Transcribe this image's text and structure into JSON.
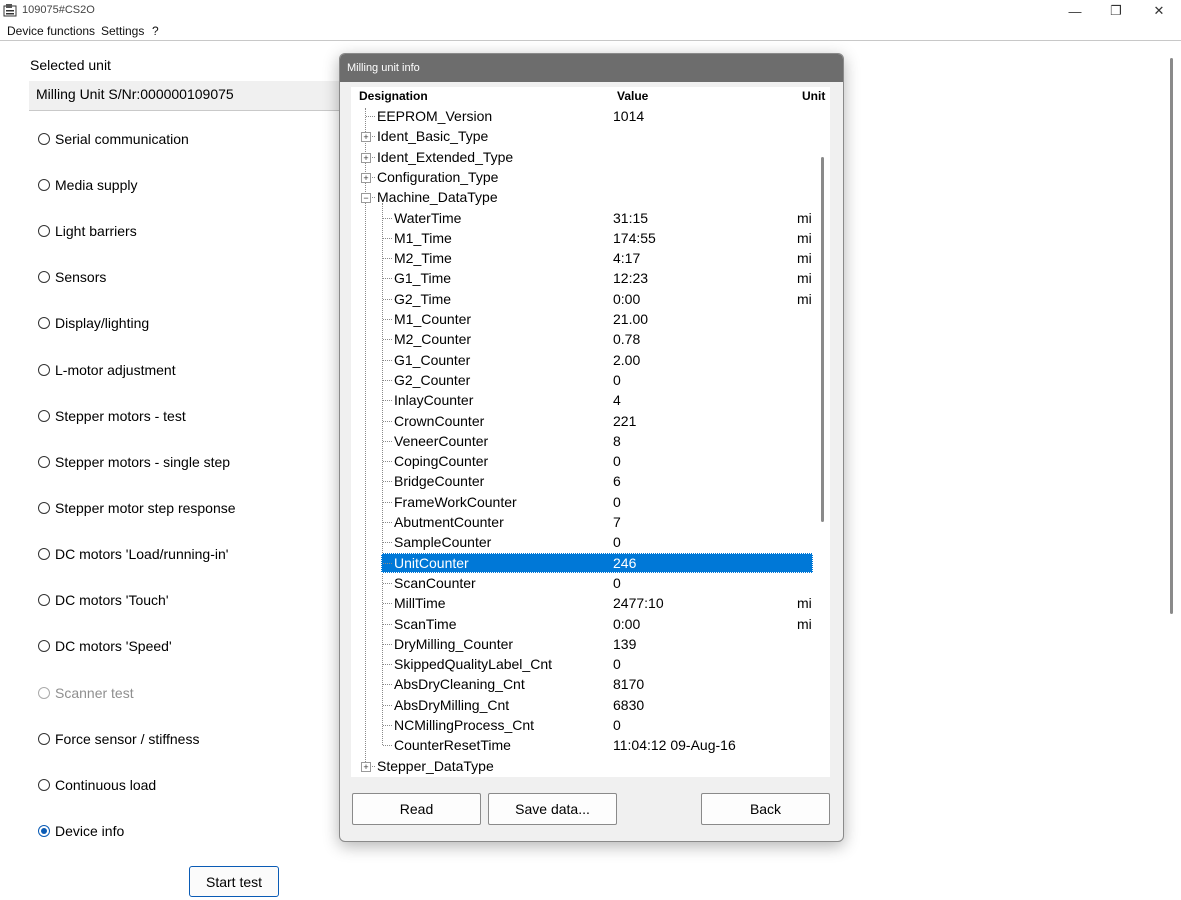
{
  "window": {
    "title": "109075#CS2O",
    "minimize_glyph": "—",
    "maximize_glyph": "❐",
    "close_glyph": "✕"
  },
  "menu": [
    "Device functions",
    "Settings",
    "?"
  ],
  "left_panel": {
    "selected_unit_label": "Selected unit",
    "unit_value": "Milling Unit S/Nr:000000109075",
    "tests": [
      {
        "label": "Serial communication",
        "state": "unchecked"
      },
      {
        "label": "Media supply",
        "state": "unchecked"
      },
      {
        "label": "Light barriers",
        "state": "unchecked"
      },
      {
        "label": "Sensors",
        "state": "unchecked"
      },
      {
        "label": "Display/lighting",
        "state": "unchecked"
      },
      {
        "label": "L-motor adjustment",
        "state": "unchecked"
      },
      {
        "label": "Stepper motors - test",
        "state": "unchecked"
      },
      {
        "label": "Stepper motors - single step",
        "state": "unchecked"
      },
      {
        "label": "Stepper motor step response",
        "state": "unchecked"
      },
      {
        "label": "DC motors 'Load/running-in'",
        "state": "unchecked"
      },
      {
        "label": "DC motors 'Touch'",
        "state": "unchecked"
      },
      {
        "label": "DC motors 'Speed'",
        "state": "unchecked"
      },
      {
        "label": "Scanner test",
        "state": "disabled"
      },
      {
        "label": "Force sensor / stiffness",
        "state": "unchecked"
      },
      {
        "label": "Continuous load",
        "state": "unchecked"
      },
      {
        "label": "Device info",
        "state": "checked"
      }
    ],
    "start_button": "Start test"
  },
  "dialog": {
    "title": "Milling unit info",
    "columns": {
      "designation": "Designation",
      "value": "Value",
      "unit": "Unit"
    },
    "rows": [
      {
        "name": "EEPROM_Version",
        "value": "1014",
        "unit": "",
        "level": 0,
        "expander": ""
      },
      {
        "name": "Ident_Basic_Type",
        "value": "",
        "unit": "",
        "level": 0,
        "expander": "+"
      },
      {
        "name": "Ident_Extended_Type",
        "value": "",
        "unit": "",
        "level": 0,
        "expander": "+"
      },
      {
        "name": "Configuration_Type",
        "value": "",
        "unit": "",
        "level": 0,
        "expander": "+"
      },
      {
        "name": "Machine_DataType",
        "value": "",
        "unit": "",
        "level": 0,
        "expander": "-"
      },
      {
        "name": "WaterTime",
        "value": "31:15",
        "unit": "mi",
        "level": 1,
        "expander": ""
      },
      {
        "name": "M1_Time",
        "value": "174:55",
        "unit": "mi",
        "level": 1,
        "expander": ""
      },
      {
        "name": "M2_Time",
        "value": "4:17",
        "unit": "mi",
        "level": 1,
        "expander": ""
      },
      {
        "name": "G1_Time",
        "value": "12:23",
        "unit": "mi",
        "level": 1,
        "expander": ""
      },
      {
        "name": "G2_Time",
        "value": "0:00",
        "unit": "mi",
        "level": 1,
        "expander": ""
      },
      {
        "name": "M1_Counter",
        "value": "21.00",
        "unit": "",
        "level": 1,
        "expander": ""
      },
      {
        "name": "M2_Counter",
        "value": "0.78",
        "unit": "",
        "level": 1,
        "expander": ""
      },
      {
        "name": "G1_Counter",
        "value": "2.00",
        "unit": "",
        "level": 1,
        "expander": ""
      },
      {
        "name": "G2_Counter",
        "value": "0",
        "unit": "",
        "level": 1,
        "expander": ""
      },
      {
        "name": "InlayCounter",
        "value": "4",
        "unit": "",
        "level": 1,
        "expander": ""
      },
      {
        "name": "CrownCounter",
        "value": "221",
        "unit": "",
        "level": 1,
        "expander": ""
      },
      {
        "name": "VeneerCounter",
        "value": "8",
        "unit": "",
        "level": 1,
        "expander": ""
      },
      {
        "name": "CopingCounter",
        "value": "0",
        "unit": "",
        "level": 1,
        "expander": ""
      },
      {
        "name": "BridgeCounter",
        "value": "6",
        "unit": "",
        "level": 1,
        "expander": ""
      },
      {
        "name": "FrameWorkCounter",
        "value": "0",
        "unit": "",
        "level": 1,
        "expander": ""
      },
      {
        "name": "AbutmentCounter",
        "value": "7",
        "unit": "",
        "level": 1,
        "expander": ""
      },
      {
        "name": "SampleCounter",
        "value": "0",
        "unit": "",
        "level": 1,
        "expander": ""
      },
      {
        "name": "UnitCounter",
        "value": "246",
        "unit": "",
        "level": 1,
        "expander": "",
        "selected": true
      },
      {
        "name": "ScanCounter",
        "value": "0",
        "unit": "",
        "level": 1,
        "expander": ""
      },
      {
        "name": "MillTime",
        "value": "2477:10",
        "unit": "mi",
        "level": 1,
        "expander": ""
      },
      {
        "name": "ScanTime",
        "value": "0:00",
        "unit": "mi",
        "level": 1,
        "expander": ""
      },
      {
        "name": "DryMilling_Counter",
        "value": "139",
        "unit": "",
        "level": 1,
        "expander": ""
      },
      {
        "name": "SkippedQualityLabel_Cnt",
        "value": "0",
        "unit": "",
        "level": 1,
        "expander": ""
      },
      {
        "name": "AbsDryCleaning_Cnt",
        "value": "8170",
        "unit": "",
        "level": 1,
        "expander": ""
      },
      {
        "name": "AbsDryMilling_Cnt",
        "value": "6830",
        "unit": "",
        "level": 1,
        "expander": ""
      },
      {
        "name": "NCMillingProcess_Cnt",
        "value": "0",
        "unit": "",
        "level": 1,
        "expander": ""
      },
      {
        "name": "CounterResetTime",
        "value": "11:04:12 09-Aug-16",
        "unit": "",
        "level": 1,
        "expander": ""
      },
      {
        "name": "Stepper_DataType",
        "value": "",
        "unit": "",
        "level": 0,
        "expander": "+"
      }
    ],
    "buttons": {
      "read": "Read",
      "save": "Save data...",
      "back": "Back"
    }
  },
  "colors": {
    "selection": "#0078d7",
    "radio_checked": "#0a5bb5",
    "dialog_title_bar": "#6d6d6d"
  }
}
